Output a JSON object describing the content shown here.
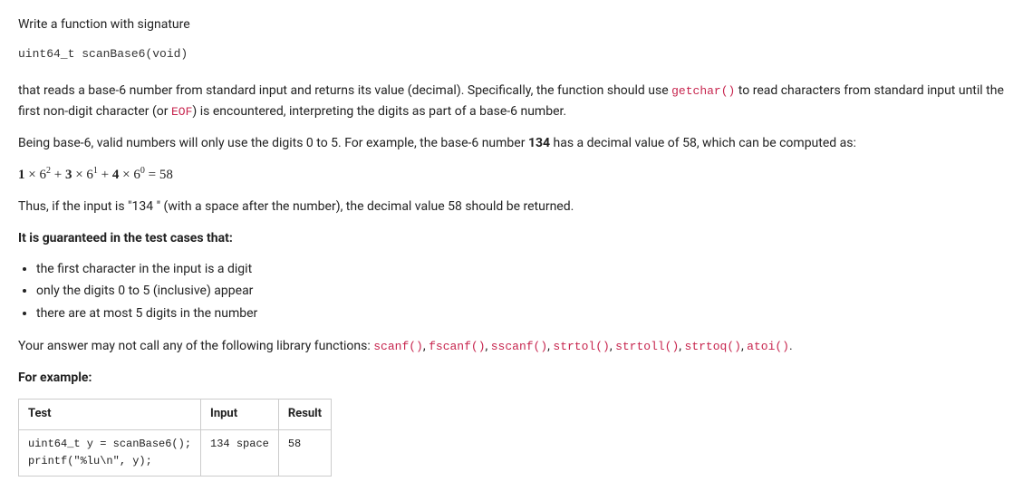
{
  "intro": {
    "line1": "Write a function with signature",
    "signature": "uint64_t scanBase6(void)"
  },
  "desc": {
    "part1": "that reads a base-6 number from standard input and returns its value (decimal). Specifically, the function should use ",
    "getchar": "getchar()",
    "part2": " to read characters from standard input until the first non-digit character (or ",
    "eof": "EOF",
    "part3": ") is encountered, interpreting the digits as part of a base-6 number."
  },
  "base6": {
    "part1": "Being base-6, valid numbers will only use the digits 0 to 5. For example, the base-6 number ",
    "num": "134",
    "part2": " has a decimal value of 58, which can be computed as:"
  },
  "equation": {
    "c1": "1",
    "b1": "6",
    "e1": "2",
    "c2": "3",
    "b2": "6",
    "e2": "1",
    "c3": "4",
    "b3": "6",
    "e3": "0",
    "eq": "58"
  },
  "thus": "Thus, if the input is \"134 \" (with a space after the number), the decimal value 58 should be returned.",
  "guarantee_heading": "It is guaranteed in the test cases that:",
  "guarantees": [
    "the first character in the input is a digit",
    "only the digits 0 to 5 (inclusive) appear",
    "there are at most 5 digits in the number"
  ],
  "forbidden": {
    "lead": "Your answer may not call any of the following library functions: ",
    "fns": [
      "scanf()",
      "fscanf()",
      "sscanf()",
      "strtol()",
      "strtoll()",
      "strtoq()",
      "atoi()"
    ],
    "tail": "."
  },
  "example_heading": "For example:",
  "table": {
    "headers": {
      "test": "Test",
      "input": "Input",
      "result": "Result"
    },
    "row": {
      "test": "uint64_t y = scanBase6();\nprintf(\"%lu\\n\", y);",
      "input": "134 space",
      "result": "58"
    }
  }
}
